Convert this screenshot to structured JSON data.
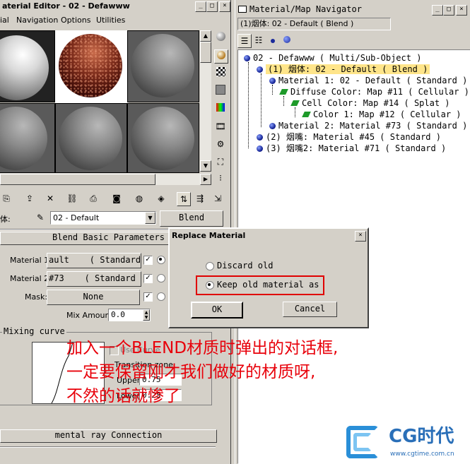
{
  "material_editor": {
    "title": "aterial Editor - 02 - Defawww",
    "menu": [
      "ial",
      "Navigation",
      "Options",
      "Utilities"
    ],
    "label_ti": "体:",
    "mtl_name": "02 - Default",
    "type_button": "Blend",
    "rollout_title": "Blend Basic Parameters",
    "material1_label": "Material 1:",
    "material1_value": "ault    ( Standard )",
    "material2_label": "Material 2:",
    "material2_value": "#73    ( Standard )",
    "mask_label": "Mask:",
    "mask_value": "None",
    "mix_amount_label": "Mix Amount:",
    "mix_amount_value": "0.0",
    "mixing_curve_label": "Mixing curve",
    "use_curve_label": "Use Curve",
    "transition_zone_label": "Transition zone:",
    "upper_label": "Upper:",
    "upper_value": "0.75",
    "lower_label": "Lower:",
    "lower_value": "0.25",
    "mental_ray": "mental ray Connection"
  },
  "navigator": {
    "title": "Material/Map Navigator",
    "path": "(1)烟体: 02 - Default ( Blend )",
    "tree": [
      {
        "text": "02 - Defawww   ( Multi/Sub-Object )",
        "kind": "dot"
      },
      {
        "text": "(1) 烟体: 02 - Default   ( Blend )",
        "kind": "dot",
        "selected": true
      },
      {
        "text": "Material 1: 02 - Default   ( Standard )",
        "kind": "dot"
      },
      {
        "text": "Diffuse Color: Map #11   ( Cellular )",
        "kind": "para"
      },
      {
        "text": "Cell Color: Map #14   ( Splat )",
        "kind": "para"
      },
      {
        "text": "Color 1: Map #12   ( Cellular )",
        "kind": "para"
      },
      {
        "text": "Material 2: Material #73   ( Standard )",
        "kind": "dot"
      },
      {
        "text": "(2) 烟嘴: Material #45   ( Standard )",
        "kind": "dot"
      },
      {
        "text": "(3) 烟嘴2: Material #71   ( Standard )",
        "kind": "dot"
      }
    ]
  },
  "dialog": {
    "title": "Replace Material",
    "discard_label": "Discard old",
    "keep_label": "Keep old material as",
    "ok_label": "OK",
    "cancel_label": "Cancel"
  },
  "annotation": {
    "line1": "加入一个BLEND材质时弹出的对话框,",
    "line2": "一定要保留刚才我们做好的材质呀,",
    "line3": "不然的话就惨了"
  },
  "logo": {
    "brand": "CG时代",
    "url": "www.cgtime.com.cn"
  },
  "colors": {
    "selection": "#ffe58a",
    "annotation_red": "#e8000a",
    "highlight_box": "#e00000"
  }
}
